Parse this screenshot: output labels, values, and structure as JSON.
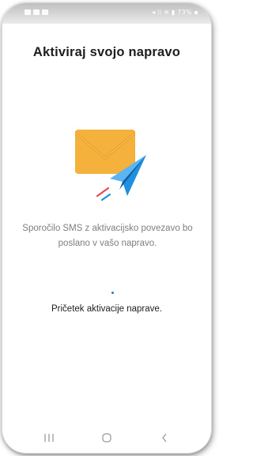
{
  "app": {
    "title": "Aktiviraj svojo napravo",
    "message": "Sporočilo SMS z aktivacijsko povezavo bo poslano v vašo napravo.",
    "status": "Pričetek aktivacije naprave."
  },
  "status_bar": {
    "right_text": "◂ ⁞⁞ ≋ ▮ 73% ▪"
  },
  "illustration": {
    "icon": "envelope-paper-plane-icon",
    "colors": {
      "envelope": "#f4b23c",
      "envelope_flap": "#e79b27",
      "plane": "#1f8fe0",
      "plane_dark": "#0f5fa8",
      "trail": "#e34a58"
    }
  },
  "nav": {
    "buttons": [
      "recent-apps",
      "home",
      "back"
    ]
  },
  "colors": {
    "accent": "#2a73c7"
  }
}
